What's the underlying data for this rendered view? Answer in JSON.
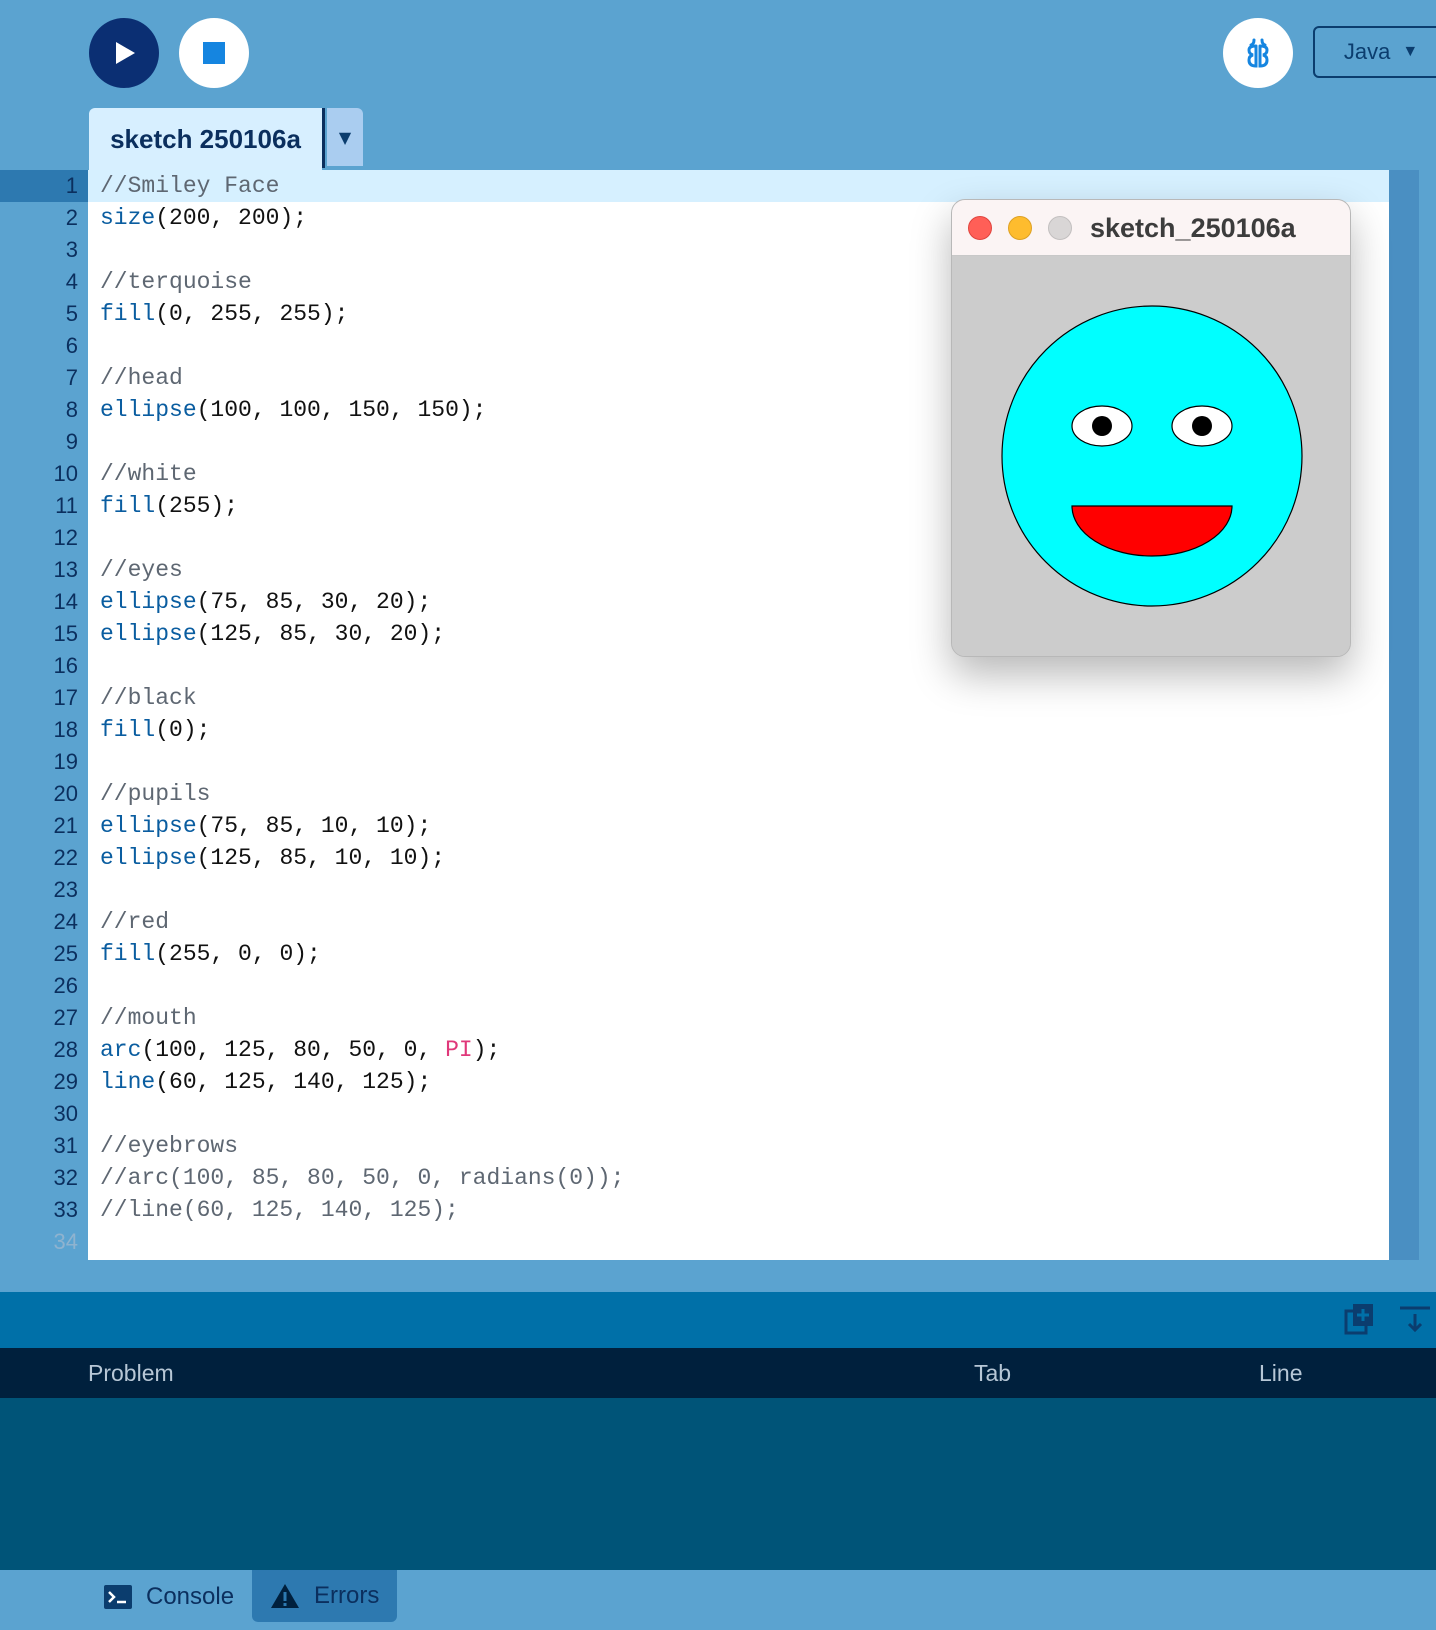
{
  "toolbar": {
    "run_icon": "play-icon",
    "stop_icon": "stop-icon",
    "debug_icon": "debugger-icon",
    "mode": "Java"
  },
  "tab": {
    "name": "sketch 250106a"
  },
  "editor": {
    "active_line": 1,
    "lines": [
      {
        "n": "1",
        "code": "//Smiley Face"
      },
      {
        "n": "2",
        "code": "size(200, 200);"
      },
      {
        "n": "3",
        "code": ""
      },
      {
        "n": "4",
        "code": "//terquoise"
      },
      {
        "n": "5",
        "code": "fill(0, 255, 255);"
      },
      {
        "n": "6",
        "code": ""
      },
      {
        "n": "7",
        "code": "//head"
      },
      {
        "n": "8",
        "code": "ellipse(100, 100, 150, 150);"
      },
      {
        "n": "9",
        "code": ""
      },
      {
        "n": "10",
        "code": "//white"
      },
      {
        "n": "11",
        "code": "fill(255);"
      },
      {
        "n": "12",
        "code": ""
      },
      {
        "n": "13",
        "code": "//eyes"
      },
      {
        "n": "14",
        "code": "ellipse(75, 85, 30, 20);"
      },
      {
        "n": "15",
        "code": "ellipse(125, 85, 30, 20);"
      },
      {
        "n": "16",
        "code": ""
      },
      {
        "n": "17",
        "code": "//black"
      },
      {
        "n": "18",
        "code": "fill(0);"
      },
      {
        "n": "19",
        "code": ""
      },
      {
        "n": "20",
        "code": "//pupils"
      },
      {
        "n": "21",
        "code": "ellipse(75, 85, 10, 10);"
      },
      {
        "n": "22",
        "code": "ellipse(125, 85, 10, 10);"
      },
      {
        "n": "23",
        "code": ""
      },
      {
        "n": "24",
        "code": "//red"
      },
      {
        "n": "25",
        "code": "fill(255, 0, 0);"
      },
      {
        "n": "26",
        "code": ""
      },
      {
        "n": "27",
        "code": "//mouth"
      },
      {
        "n": "28",
        "code": "arc(100, 125, 80, 50, 0, PI);"
      },
      {
        "n": "29",
        "code": "line(60, 125, 140, 125);"
      },
      {
        "n": "30",
        "code": ""
      },
      {
        "n": "31",
        "code": "//eyebrows"
      },
      {
        "n": "32",
        "code": "//arc(100, 85, 80, 50, 0, radians(0));"
      },
      {
        "n": "33",
        "code": "//line(60, 125, 140, 125);"
      },
      {
        "n": "34",
        "code": ""
      }
    ]
  },
  "sketch_window": {
    "title": "sketch_250106a",
    "background": "#cccccc",
    "head_color": "#00ffff",
    "eye_color": "#ffffff",
    "pupil_color": "#000000",
    "mouth_color": "#ff0000"
  },
  "panel": {
    "columns": {
      "problem": "Problem",
      "tab": "Tab",
      "line": "Line"
    },
    "tabs": {
      "console": "Console",
      "errors": "Errors"
    }
  },
  "colors": {
    "toolbar_bg": "#5ba3d0",
    "run_button": "#0b2f73",
    "keyword": "#0a5da0",
    "comment": "#5e6772",
    "constant": "#e0387a"
  }
}
